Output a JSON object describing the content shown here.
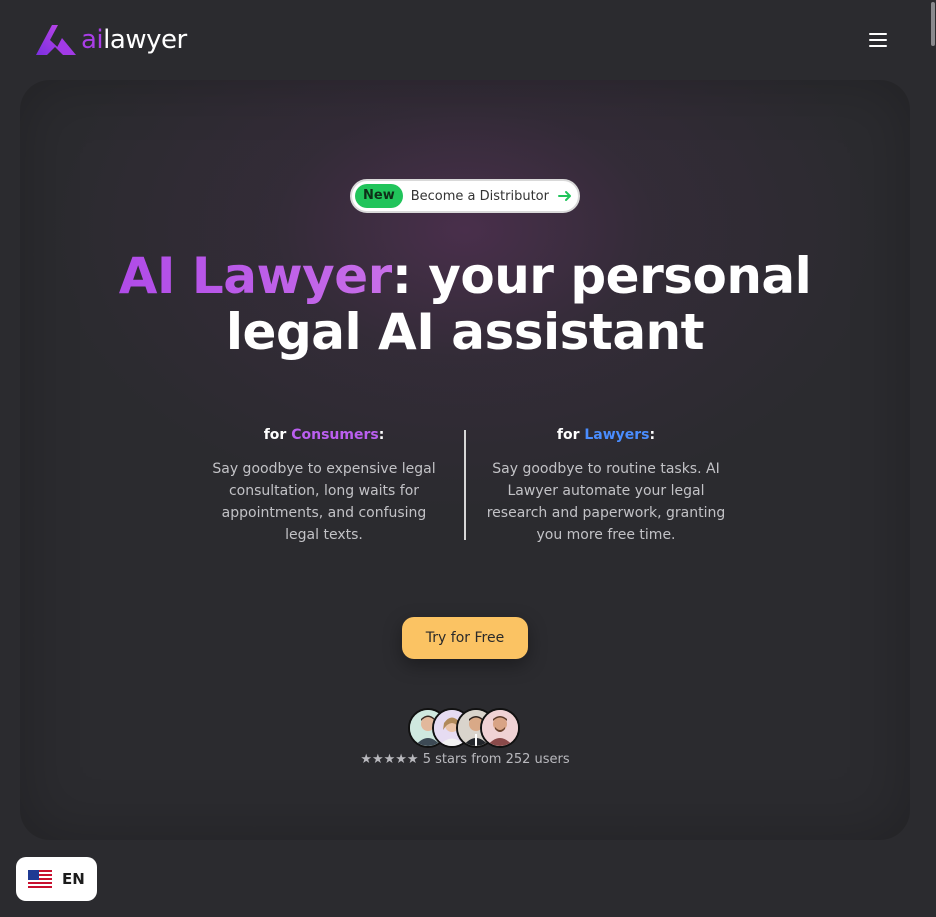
{
  "header": {
    "logo_ai": "ai",
    "logo_lawyer": "lawyer",
    "menu_icon": "hamburger-menu-icon"
  },
  "hero": {
    "badge_new": "New",
    "distributor_label": "Become a Distributor",
    "distributor_arrow_icon": "arrow-right-icon",
    "headline_accent": "AI Lawyer",
    "headline_rest": ": your personal legal AI assistant",
    "consumers": {
      "prefix": "for ",
      "highlight": "Consumers",
      "suffix": ":",
      "body": "Say goodbye to expensive legal consultation, long waits for appointments, and confusing legal texts."
    },
    "lawyers": {
      "prefix": "for ",
      "highlight": "Lawyers",
      "suffix": ":",
      "body": "Say goodbye to routine tasks. AI Lawyer automate your legal research and paperwork, granting you more free time."
    },
    "cta_label": "Try for Free",
    "rating_text": "★★★★★ 5 stars from 252 users"
  },
  "language": {
    "flag_icon": "us-flag-icon",
    "label": "EN"
  },
  "colors": {
    "background": "#2b2b2f",
    "accent_purple": "#a93ee6",
    "accent_blue": "#4a8dff",
    "cta": "#fbc363",
    "badge_green": "#21c45b"
  }
}
